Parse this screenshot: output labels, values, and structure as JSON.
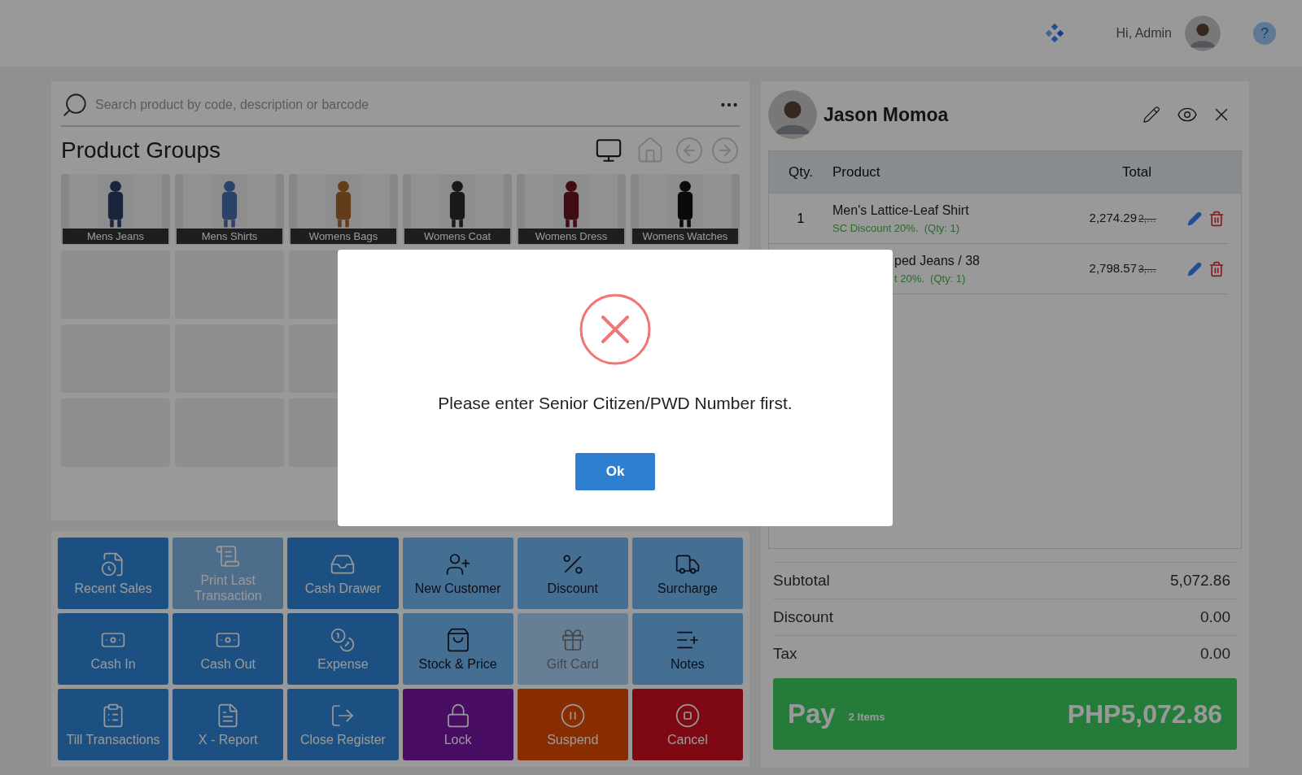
{
  "top_bar": {
    "greeting": "Hi, Admin",
    "help": "?"
  },
  "search": {
    "placeholder": "Search product by code, description or barcode"
  },
  "product_groups": {
    "title": "Product Groups",
    "groups": [
      {
        "name": "Mens Jeans"
      },
      {
        "name": "Mens Shirts"
      },
      {
        "name": "Womens Bags"
      },
      {
        "name": "Womens Coat"
      },
      {
        "name": "Womens Dress"
      },
      {
        "name": "Womens Watches"
      }
    ]
  },
  "actions": [
    {
      "label": "Recent Sales",
      "kind": "primary",
      "disabled": false
    },
    {
      "label": "Print Last Transaction",
      "kind": "primary",
      "disabled": true
    },
    {
      "label": "Cash Drawer",
      "kind": "primary",
      "disabled": false
    },
    {
      "label": "New Customer",
      "kind": "secondary",
      "disabled": false
    },
    {
      "label": "Discount",
      "kind": "secondary",
      "disabled": false
    },
    {
      "label": "Surcharge",
      "kind": "secondary",
      "disabled": false
    },
    {
      "label": "Cash In",
      "kind": "primary",
      "disabled": false
    },
    {
      "label": "Cash Out",
      "kind": "primary",
      "disabled": false
    },
    {
      "label": "Expense",
      "kind": "primary",
      "disabled": false
    },
    {
      "label": "Stock & Price",
      "kind": "secondary",
      "disabled": false
    },
    {
      "label": "Gift Card",
      "kind": "secondary",
      "disabled": true
    },
    {
      "label": "Notes",
      "kind": "secondary",
      "disabled": false
    },
    {
      "label": "Till Transactions",
      "kind": "primary",
      "disabled": false
    },
    {
      "label": "X - Report",
      "kind": "primary",
      "disabled": false
    },
    {
      "label": "Close Register",
      "kind": "primary",
      "disabled": false
    },
    {
      "label": "Lock",
      "kind": "lock",
      "disabled": false
    },
    {
      "label": "Suspend",
      "kind": "suspend",
      "disabled": false
    },
    {
      "label": "Cancel",
      "kind": "cancel",
      "disabled": false
    }
  ],
  "customer": {
    "name": "Jason Momoa"
  },
  "cart": {
    "columns": [
      "Qty.",
      "Product",
      "Total"
    ],
    "rows": [
      {
        "qty": "1",
        "product": "Men's Lattice-Leaf Shirt",
        "note": "SC Discount 20%.  (Qty: 1)",
        "total": "2,274.29",
        "original": "2,…",
        "clipped": false
      },
      {
        "product": "ped Jeans / 38",
        "note": "t 20%.  (Qty: 1)",
        "total": "2,798.57",
        "original": "3,…",
        "clipped": true
      }
    ]
  },
  "summary": [
    {
      "label": "Subtotal",
      "value": "5,072.86"
    },
    {
      "label": "Discount",
      "value": "0.00"
    },
    {
      "label": "Tax",
      "value": "0.00"
    }
  ],
  "pay": {
    "label": "Pay",
    "count": "2 Items",
    "amount": "PHP5,072.86"
  },
  "dialog": {
    "message": "Please enter Senior Citizen/PWD Number first.",
    "button": "Ok"
  }
}
